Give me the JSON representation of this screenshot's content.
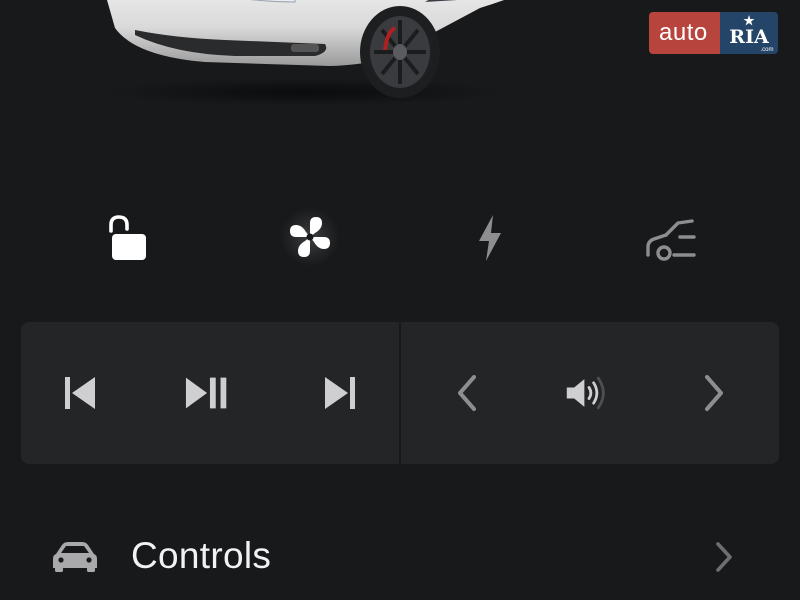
{
  "watermark": {
    "left_text": "auto",
    "right_text": "RIA",
    "right_subtext": ".com"
  },
  "hero": {
    "image": "car-front-view"
  },
  "quick_controls": [
    {
      "name": "lock",
      "icon": "unlock-icon",
      "state": "unlocked"
    },
    {
      "name": "climate",
      "icon": "fan-icon",
      "state": "active"
    },
    {
      "name": "charging",
      "icon": "lightning-icon"
    },
    {
      "name": "trunk",
      "icon": "car-trunk-icon"
    }
  ],
  "media": {
    "left_controls": [
      {
        "name": "previous",
        "icon": "skip-previous-icon"
      },
      {
        "name": "play-pause",
        "icon": "play-pause-icon"
      },
      {
        "name": "next",
        "icon": "skip-next-icon"
      }
    ],
    "right_controls": [
      {
        "name": "volume-down",
        "icon": "chevron-left-icon"
      },
      {
        "name": "volume",
        "icon": "speaker-icon"
      },
      {
        "name": "volume-up",
        "icon": "chevron-right-icon"
      }
    ]
  },
  "menu": {
    "controls_label": "Controls",
    "controls_icon": "car-icon"
  },
  "colors": {
    "background": "#18191b",
    "panel": "#242527",
    "icon_active": "#ffffff",
    "icon_inactive": "#8e8e90",
    "text": "#f2f2f2",
    "watermark_red": "#b8453d",
    "watermark_blue": "#244567"
  }
}
